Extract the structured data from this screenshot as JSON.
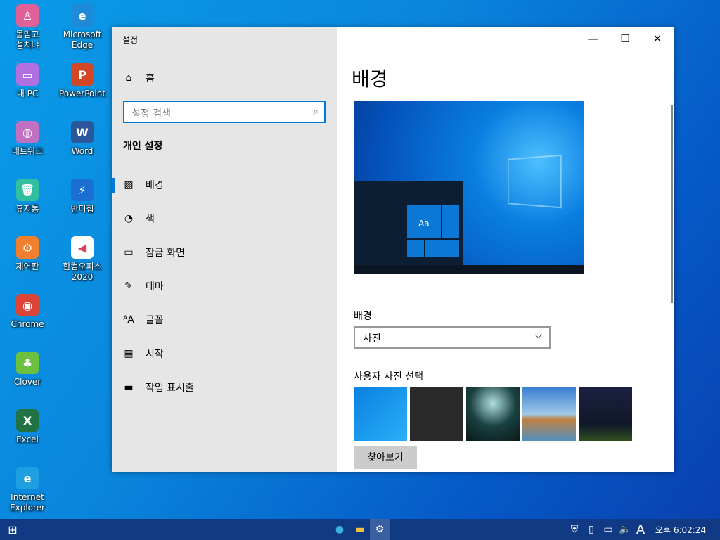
{
  "desktop": {
    "icons": [
      {
        "label": "몰밈고\n설치냐",
        "icon": "user-hanger-icon",
        "color": "#e0609a"
      },
      {
        "label": "Microsoft Edge",
        "icon": "edge-icon",
        "color": "#1f8ad8"
      },
      {
        "label": "내 PC",
        "icon": "monitor-icon",
        "color": "#b070e0"
      },
      {
        "label": "PowerPoint",
        "icon": "powerpoint-icon",
        "color": "#d24726"
      },
      {
        "label": "네트워크",
        "icon": "globe-icon",
        "color": "#c070c0"
      },
      {
        "label": "Word",
        "icon": "word-icon",
        "color": "#2b579a"
      },
      {
        "label": "휴지통",
        "icon": "trash-icon",
        "color": "#30c0a0"
      },
      {
        "label": "반디집",
        "icon": "bandizip-icon",
        "color": "#1a6fd0"
      },
      {
        "label": "제어판",
        "icon": "gear-icon",
        "color": "#f08030"
      },
      {
        "label": "한컴오피스 2020",
        "icon": "hancom-icon",
        "color": "#ffffff"
      },
      {
        "label": "Chrome",
        "icon": "chrome-icon",
        "color": "#db4437"
      },
      {
        "label": "Clover",
        "icon": "clover-icon",
        "color": "#6cc040"
      },
      {
        "label": "Excel",
        "icon": "excel-icon",
        "color": "#217346"
      },
      {
        "label": "Internet Explorer",
        "icon": "ie-icon",
        "color": "#1ea0e0"
      }
    ]
  },
  "window": {
    "title": "설정",
    "minimize": "—",
    "maximize": "☐",
    "close": "✕"
  },
  "sidebar": {
    "home": "홈",
    "search_placeholder": "설정 검색",
    "section": "개인 설정",
    "items": [
      {
        "label": "배경",
        "icon": "image-icon"
      },
      {
        "label": "색",
        "icon": "palette-icon"
      },
      {
        "label": "잠금 화면",
        "icon": "lock-screen-icon"
      },
      {
        "label": "테마",
        "icon": "theme-icon"
      },
      {
        "label": "글꼴",
        "icon": "font-icon"
      },
      {
        "label": "시작",
        "icon": "start-icon"
      },
      {
        "label": "작업 표시줄",
        "icon": "taskbar-icon"
      }
    ]
  },
  "main": {
    "title": "배경",
    "preview_tile": "Aa",
    "background_label": "배경",
    "background_value": "사진",
    "choose_label": "사용자 사진 선택",
    "browse": "찾아보기"
  },
  "taskbar": {
    "ime": "A",
    "clock": "오후 6:02:24"
  },
  "colors": {
    "accent": "#0078d7",
    "taskbar": "#103b84"
  }
}
